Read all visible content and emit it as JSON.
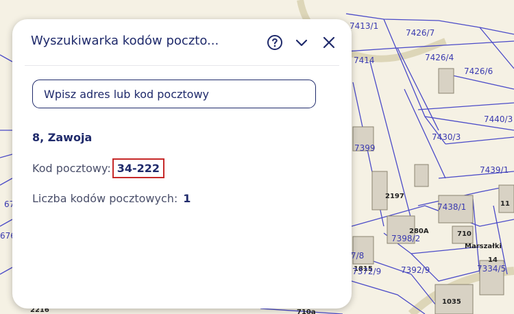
{
  "map": {
    "parcel_labels": [
      "7413/1",
      "7426/7",
      "7414",
      "7426/4",
      "7426/6",
      "7440/3",
      "7430/3",
      "7399",
      "7439/1",
      "11",
      "2197",
      "7438/1",
      "280A",
      "7398/2",
      "710",
      "Marszałki",
      "7/8",
      "1815",
      "7372/9",
      "7392/9",
      "14",
      "7334/5",
      "1035",
      "67",
      "676",
      "2216",
      "710a"
    ]
  },
  "panel": {
    "title": "Wyszukiwarka kodów poczto...",
    "search_placeholder": "Wpisz adres lub kod pocztowy",
    "address": "8, Zawoja",
    "postal_code_label": "Kod pocztowy:",
    "postal_code_value": "34-222",
    "count_label": "Liczba kodów pocztowych:",
    "count_value": "1",
    "icons": [
      "help-icon",
      "chevron-down-icon",
      "close-icon"
    ]
  },
  "colors": {
    "parcel_line": "#4a4ac8",
    "panel_text": "#1f2a6b",
    "highlight_border": "#c62828"
  }
}
